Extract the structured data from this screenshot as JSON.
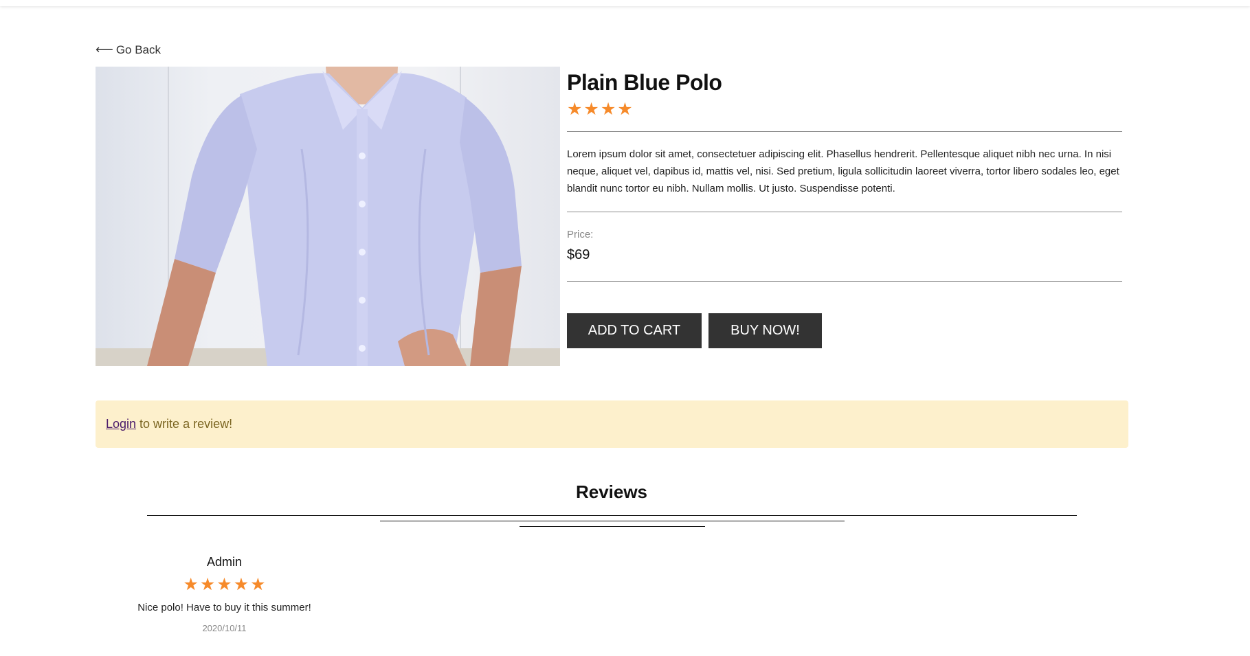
{
  "nav": {
    "back_arrow": "⟵",
    "back_label": "Go Back"
  },
  "product": {
    "image_icon": "product-photo-shirt",
    "title": "Plain Blue Polo",
    "rating_stars": 4,
    "star_glyph": "★",
    "star_color": "#f68a2a",
    "description": "Lorem ipsum dolor sit amet, consectetuer adipiscing elit. Phasellus hendrerit. Pellentesque aliquet nibh nec urna. In nisi neque, aliquet vel, dapibus id, mattis vel, nisi. Sed pretium, ligula sollicitudin laoreet viverra, tortor libero sodales leo, eget blandit nunc tortor eu nibh. Nullam mollis. Ut justo. Suspendisse potenti.",
    "price_label": "Price:",
    "price": "$69",
    "add_to_cart_label": "ADD TO CART",
    "buy_now_label": "BUY NOW!",
    "button_color": "#333333"
  },
  "review_prompt": {
    "login_link": "Login",
    "text": "to write a review!",
    "background": "#fdf0cc"
  },
  "reviews": {
    "title": "Reviews",
    "items": [
      {
        "author": "Admin",
        "rating": 5,
        "text": "Nice polo! Have to buy it this summer!",
        "date": "2020/10/11"
      }
    ]
  }
}
